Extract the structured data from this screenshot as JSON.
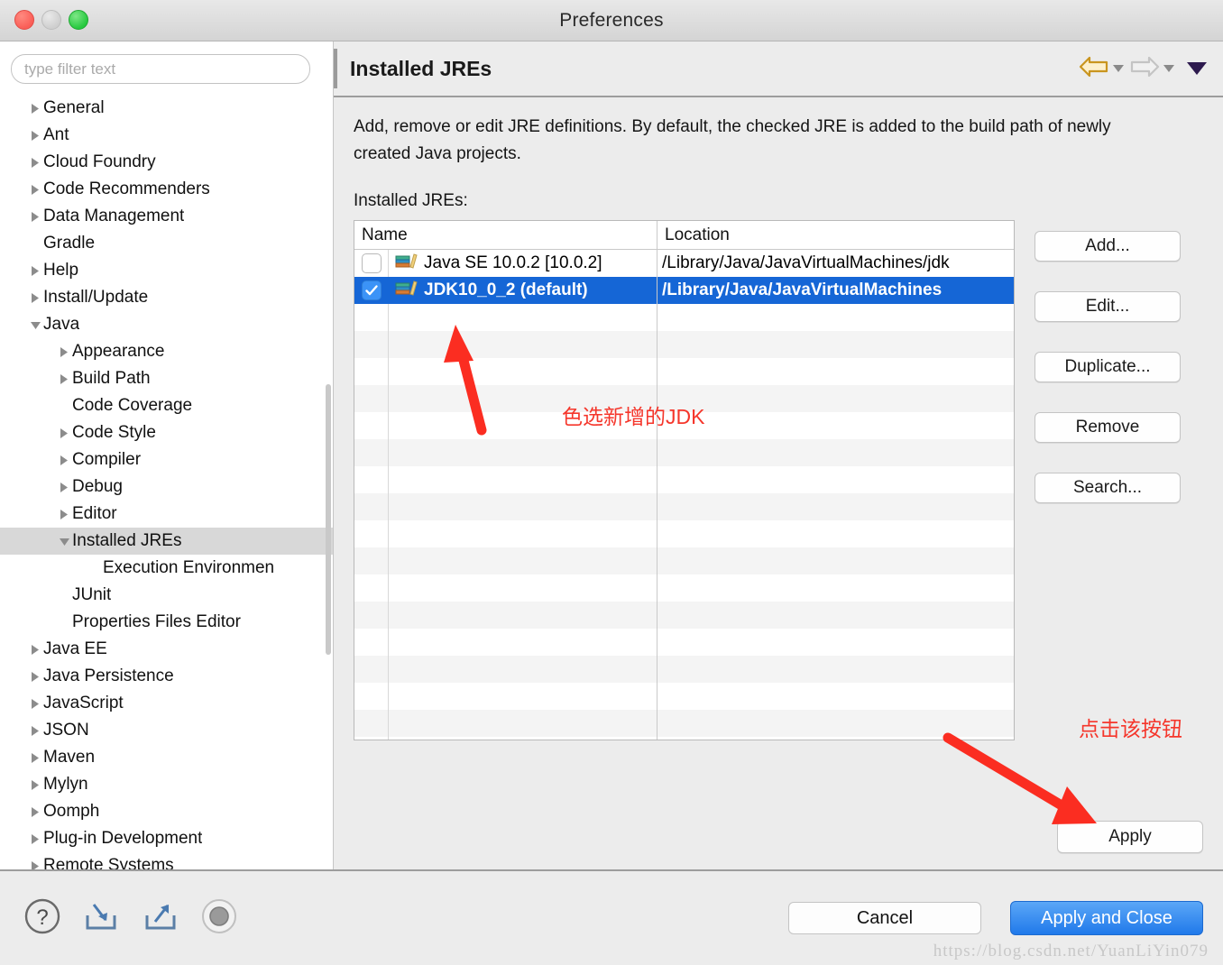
{
  "window": {
    "title": "Preferences",
    "traffic_lights": [
      "close",
      "minimize",
      "zoom"
    ]
  },
  "sidebar": {
    "filter": {
      "placeholder": "type filter text",
      "value": ""
    },
    "items": [
      {
        "label": "General",
        "level": 0,
        "expandable": true,
        "expanded": false,
        "selected": false
      },
      {
        "label": "Ant",
        "level": 0,
        "expandable": true,
        "expanded": false,
        "selected": false
      },
      {
        "label": "Cloud Foundry",
        "level": 0,
        "expandable": true,
        "expanded": false,
        "selected": false
      },
      {
        "label": "Code Recommenders",
        "level": 0,
        "expandable": true,
        "expanded": false,
        "selected": false
      },
      {
        "label": "Data Management",
        "level": 0,
        "expandable": true,
        "expanded": false,
        "selected": false
      },
      {
        "label": "Gradle",
        "level": 0,
        "expandable": false,
        "expanded": false,
        "selected": false
      },
      {
        "label": "Help",
        "level": 0,
        "expandable": true,
        "expanded": false,
        "selected": false
      },
      {
        "label": "Install/Update",
        "level": 0,
        "expandable": true,
        "expanded": false,
        "selected": false
      },
      {
        "label": "Java",
        "level": 0,
        "expandable": true,
        "expanded": true,
        "selected": false
      },
      {
        "label": "Appearance",
        "level": 1,
        "expandable": true,
        "expanded": false,
        "selected": false
      },
      {
        "label": "Build Path",
        "level": 1,
        "expandable": true,
        "expanded": false,
        "selected": false
      },
      {
        "label": "Code Coverage",
        "level": 1,
        "expandable": false,
        "expanded": false,
        "selected": false
      },
      {
        "label": "Code Style",
        "level": 1,
        "expandable": true,
        "expanded": false,
        "selected": false
      },
      {
        "label": "Compiler",
        "level": 1,
        "expandable": true,
        "expanded": false,
        "selected": false
      },
      {
        "label": "Debug",
        "level": 1,
        "expandable": true,
        "expanded": false,
        "selected": false
      },
      {
        "label": "Editor",
        "level": 1,
        "expandable": true,
        "expanded": false,
        "selected": false
      },
      {
        "label": "Installed JREs",
        "level": 1,
        "expandable": true,
        "expanded": true,
        "selected": true
      },
      {
        "label": "Execution Environmen",
        "level": 2,
        "expandable": false,
        "expanded": false,
        "selected": false
      },
      {
        "label": "JUnit",
        "level": 1,
        "expandable": false,
        "expanded": false,
        "selected": false
      },
      {
        "label": "Properties Files Editor",
        "level": 1,
        "expandable": false,
        "expanded": false,
        "selected": false
      },
      {
        "label": "Java EE",
        "level": 0,
        "expandable": true,
        "expanded": false,
        "selected": false
      },
      {
        "label": "Java Persistence",
        "level": 0,
        "expandable": true,
        "expanded": false,
        "selected": false
      },
      {
        "label": "JavaScript",
        "level": 0,
        "expandable": true,
        "expanded": false,
        "selected": false
      },
      {
        "label": "JSON",
        "level": 0,
        "expandable": true,
        "expanded": false,
        "selected": false
      },
      {
        "label": "Maven",
        "level": 0,
        "expandable": true,
        "expanded": false,
        "selected": false
      },
      {
        "label": "Mylyn",
        "level": 0,
        "expandable": true,
        "expanded": false,
        "selected": false
      },
      {
        "label": "Oomph",
        "level": 0,
        "expandable": true,
        "expanded": false,
        "selected": false
      },
      {
        "label": "Plug-in Development",
        "level": 0,
        "expandable": true,
        "expanded": false,
        "selected": false
      },
      {
        "label": "Remote Systems",
        "level": 0,
        "expandable": true,
        "expanded": false,
        "selected": false
      }
    ]
  },
  "page": {
    "title": "Installed JREs",
    "description": "Add, remove or edit JRE definitions. By default, the checked JRE is added to the build path of newly created Java projects.",
    "list_label": "Installed JREs:",
    "nav": {
      "back_icon": "back-arrow-icon",
      "back_enabled": true,
      "forward_icon": "forward-arrow-icon",
      "forward_enabled": false,
      "menu_icon": "chevron-down-icon"
    }
  },
  "table": {
    "columns": [
      "Name",
      "Location"
    ],
    "rows": [
      {
        "checked": false,
        "selected": false,
        "icon": "jre-library-icon",
        "name": "Java SE 10.0.2 [10.0.2]",
        "location": "/Library/Java/JavaVirtualMachines/jdk"
      },
      {
        "checked": true,
        "selected": true,
        "icon": "jre-library-icon",
        "name": "JDK10_0_2 (default)",
        "location": "/Library/Java/JavaVirtualMachines"
      }
    ],
    "empty_row_count": 17
  },
  "side_buttons": [
    {
      "label": "Add...",
      "name": "add-button"
    },
    {
      "label": "Edit...",
      "name": "edit-button"
    },
    {
      "label": "Duplicate...",
      "name": "duplicate-button"
    },
    {
      "label": "Remove",
      "name": "remove-button"
    },
    {
      "label": "Search...",
      "name": "search-button"
    }
  ],
  "apply_button": {
    "label": "Apply"
  },
  "footer": {
    "icons": [
      "help-icon",
      "import-icon",
      "export-icon",
      "restore-defaults-icon"
    ],
    "cancel_label": "Cancel",
    "apply_close_label": "Apply and Close",
    "watermark": "https://blog.csdn.net/YuanLiYin079"
  },
  "annotations": [
    {
      "text": "色选新增的JDK",
      "color": "#f5362b",
      "name": "annotation-select-jdk"
    },
    {
      "text": "点击该按钮",
      "color": "#f5362b",
      "name": "annotation-click-button"
    }
  ]
}
